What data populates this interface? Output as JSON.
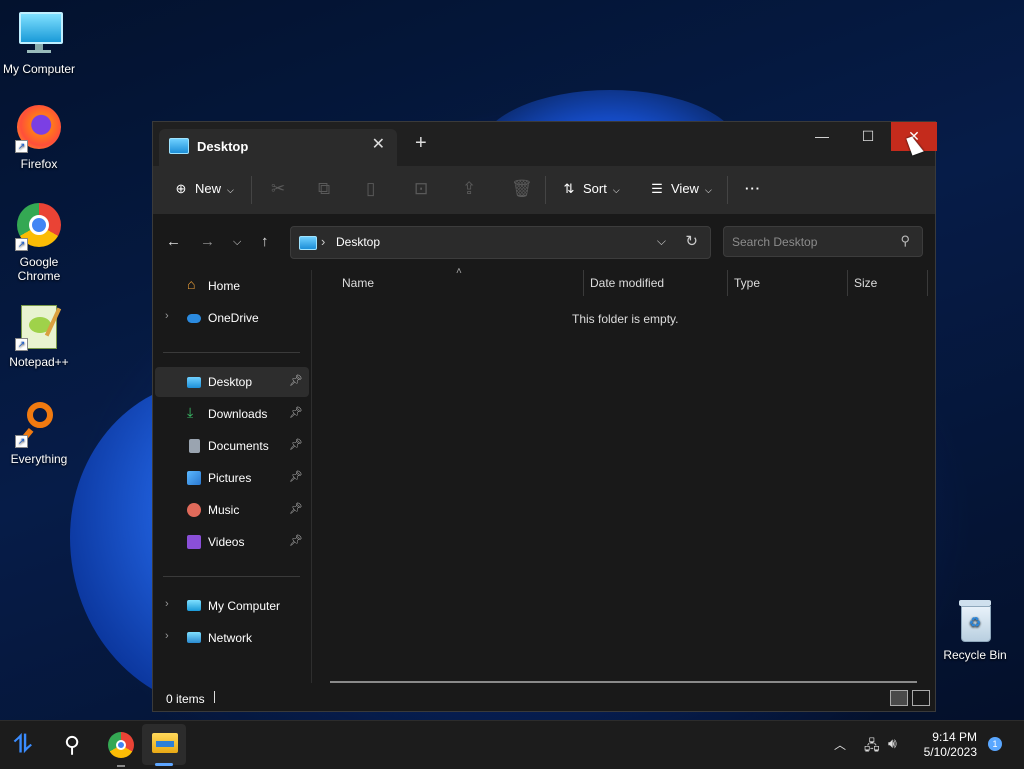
{
  "desktop": {
    "icons": [
      {
        "label": "My Computer"
      },
      {
        "label": "Firefox"
      },
      {
        "label": "Google Chrome"
      },
      {
        "label": "Notepad++"
      },
      {
        "label": "Everything"
      },
      {
        "label": "Recycle Bin"
      }
    ]
  },
  "explorer": {
    "tab_title": "Desktop",
    "toolbar": {
      "new_label": "New",
      "sort_label": "Sort",
      "view_label": "View",
      "more_label": "···"
    },
    "address": {
      "path": "Desktop"
    },
    "search": {
      "placeholder": "Search Desktop"
    },
    "sidebar": {
      "items": [
        {
          "label": "Home"
        },
        {
          "label": "OneDrive"
        },
        {
          "label": "Desktop"
        },
        {
          "label": "Downloads"
        },
        {
          "label": "Documents"
        },
        {
          "label": "Pictures"
        },
        {
          "label": "Music"
        },
        {
          "label": "Videos"
        },
        {
          "label": "My Computer"
        },
        {
          "label": "Network"
        }
      ]
    },
    "columns": [
      "Name",
      "Date modified",
      "Type",
      "Size"
    ],
    "empty_message": "This folder is empty.",
    "status": {
      "item_count": "0 items"
    }
  },
  "taskbar": {
    "time": "9:14 PM",
    "date": "5/10/2023",
    "notification_count": "1"
  },
  "colors": {
    "close_red": "#c42b1c",
    "accent_blue": "#5ea6ff"
  }
}
